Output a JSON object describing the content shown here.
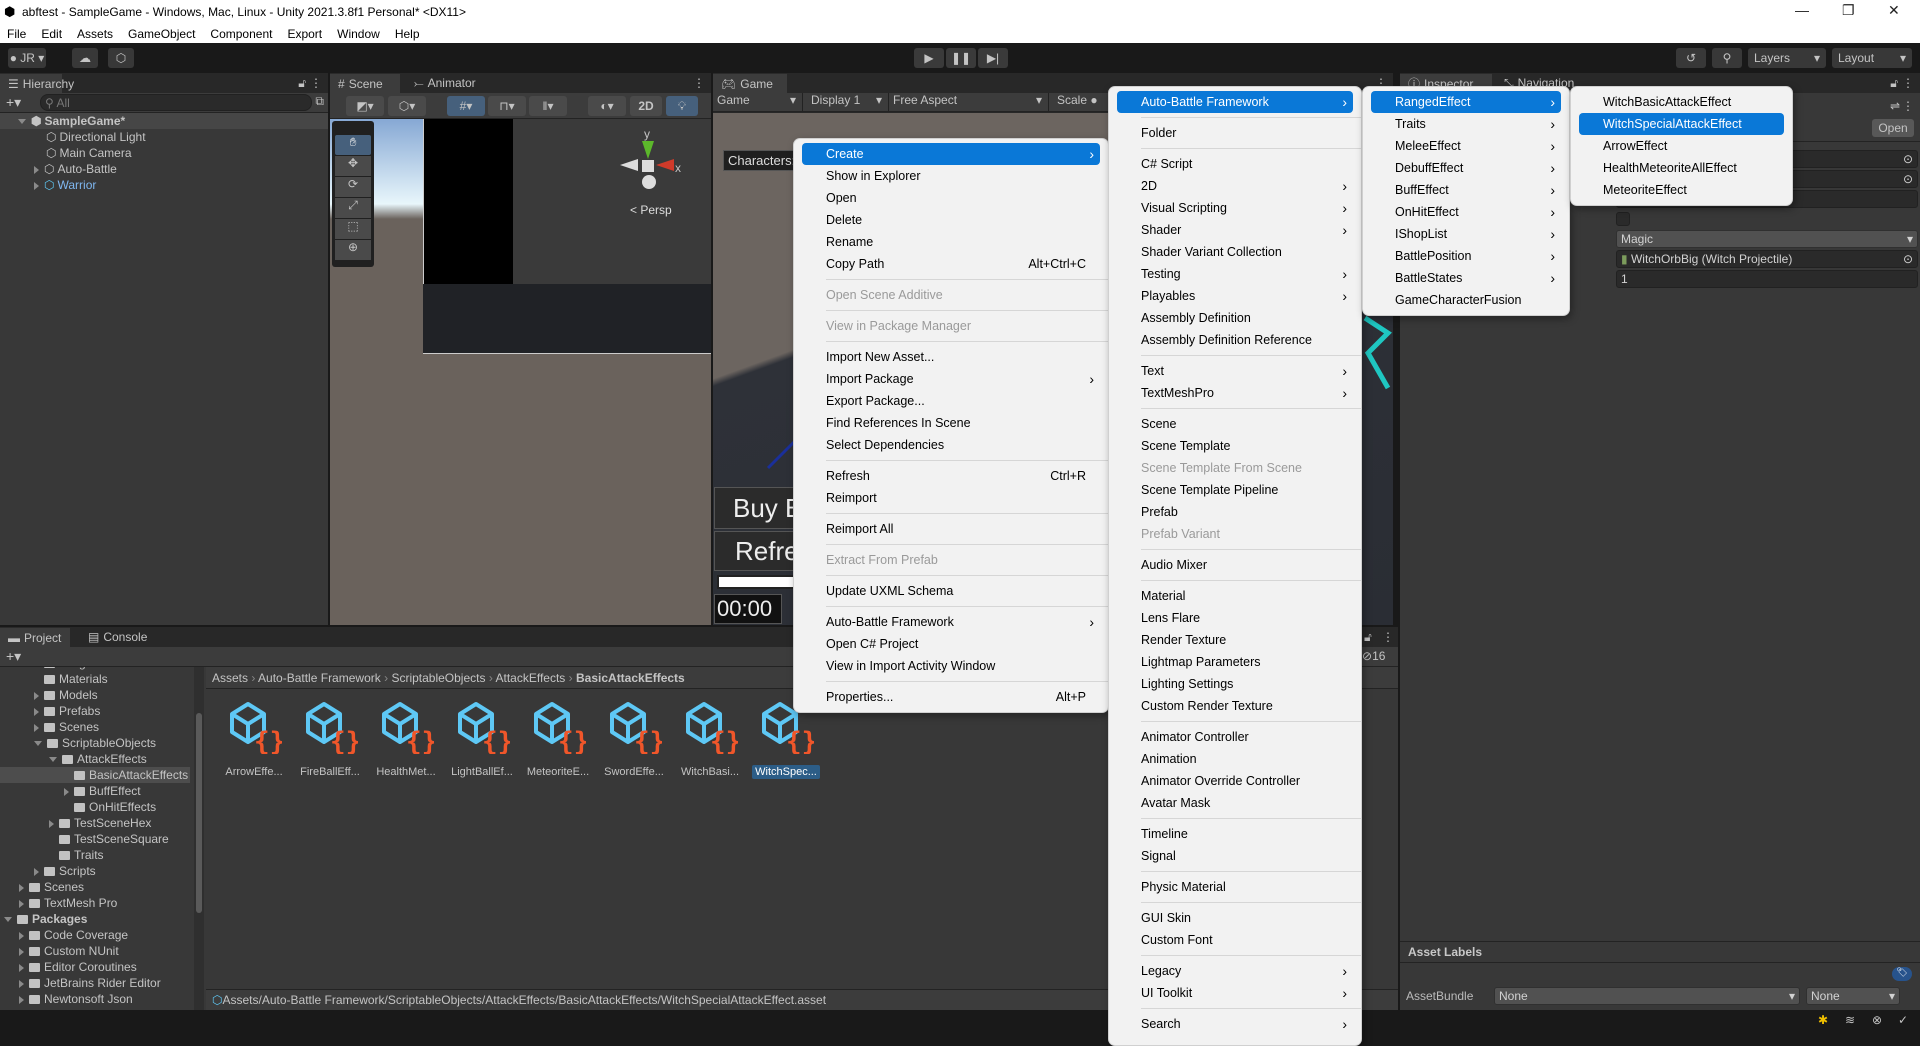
{
  "window": {
    "title": "abftest - SampleGame - Windows, Mac, Linux - Unity 2021.3.8f1 Personal* <DX11>"
  },
  "menubar": [
    "File",
    "Edit",
    "Assets",
    "GameObject",
    "Component",
    "Export",
    "Window",
    "Help"
  ],
  "toolbar": {
    "account": "JR",
    "layers": "Layers",
    "layout": "Layout"
  },
  "hierarchy": {
    "tab": "Hierarchy",
    "search_placeholder": "All",
    "items": [
      {
        "label": "SampleGame*",
        "depth": 0,
        "expanded": true,
        "scene": true
      },
      {
        "label": "Directional Light",
        "depth": 1
      },
      {
        "label": "Main Camera",
        "depth": 1
      },
      {
        "label": "Auto-Battle",
        "depth": 1,
        "collapsed": true
      },
      {
        "label": "Warrior",
        "depth": 1,
        "collapsed": true,
        "prefab": true
      }
    ]
  },
  "scene": {
    "tab": "Scene",
    "tab2": "Animator",
    "btn_2d": "2D",
    "persp": "< Persp",
    "axis_y": "y",
    "axis_x": "x"
  },
  "game": {
    "tab": "Game",
    "mode": "Game",
    "display": "Display 1",
    "aspect": "Free Aspect",
    "scale": "Scale",
    "characters": "Characters:",
    "buy": "Buy B",
    "refresh": "Refre",
    "timer": "00:00",
    "teal": "#1fc7c2"
  },
  "inspector": {
    "tab": "Inspector",
    "tab2": "Navigation",
    "open": "Open",
    "dropdown": "Magic",
    "projectile": "WitchOrbBig (Witch Projectile)",
    "number": "1",
    "asset_labels": "Asset Labels",
    "asset_bundle": "AssetBundle",
    "bundle1": "None",
    "bundle2": "None"
  },
  "project": {
    "tab": "Project",
    "tab2": "Console",
    "count": "16",
    "breadcrumb": [
      "Assets",
      "Auto-Battle Framework",
      "ScriptableObjects",
      "AttackEffects",
      "BasicAttackEffects"
    ],
    "tree": [
      {
        "label": "Images",
        "depth": 2
      },
      {
        "label": "Materials",
        "depth": 2
      },
      {
        "label": "Models",
        "depth": 2,
        "collapsed": true
      },
      {
        "label": "Prefabs",
        "depth": 2,
        "collapsed": true
      },
      {
        "label": "Scenes",
        "depth": 2,
        "collapsed": true
      },
      {
        "label": "ScriptableObjects",
        "depth": 2,
        "expanded": true
      },
      {
        "label": "AttackEffects",
        "depth": 3,
        "expanded": true
      },
      {
        "label": "BasicAttackEffects",
        "depth": 4,
        "selected": true
      },
      {
        "label": "BuffEffect",
        "depth": 4,
        "collapsed": true
      },
      {
        "label": "OnHitEffects",
        "depth": 4
      },
      {
        "label": "TestSceneHex",
        "depth": 3,
        "collapsed": true
      },
      {
        "label": "TestSceneSquare",
        "depth": 3
      },
      {
        "label": "Traits",
        "depth": 3
      },
      {
        "label": "Scripts",
        "depth": 2,
        "collapsed": true
      },
      {
        "label": "Scenes",
        "depth": 1,
        "collapsed": true
      },
      {
        "label": "TextMesh Pro",
        "depth": 1,
        "collapsed": true
      },
      {
        "label": "Packages",
        "depth": 0,
        "expanded": true,
        "bold": true
      },
      {
        "label": "Code Coverage",
        "depth": 1,
        "collapsed": true
      },
      {
        "label": "Custom NUnit",
        "depth": 1,
        "collapsed": true
      },
      {
        "label": "Editor Coroutines",
        "depth": 1,
        "collapsed": true
      },
      {
        "label": "JetBrains Rider Editor",
        "depth": 1,
        "collapsed": true
      },
      {
        "label": "Newtonsoft Json",
        "depth": 1,
        "collapsed": true
      }
    ],
    "assets": [
      {
        "label": "ArrowEffe..."
      },
      {
        "label": "FireBallEff..."
      },
      {
        "label": "HealthMet..."
      },
      {
        "label": "LightBallEf..."
      },
      {
        "label": "MeteoriteE..."
      },
      {
        "label": "SwordEffe..."
      },
      {
        "label": "WitchBasi..."
      },
      {
        "label": "WitchSpec...",
        "selected": true
      }
    ],
    "path": "Assets/Auto-Battle Framework/ScriptableObjects/AttackEffects/BasicAttackEffects/WitchSpecialAttackEffect.asset"
  },
  "context_menu": [
    {
      "label": "Create",
      "submenu": true,
      "highlighted": true
    },
    {
      "label": "Show in Explorer"
    },
    {
      "label": "Open"
    },
    {
      "label": "Delete"
    },
    {
      "label": "Rename"
    },
    {
      "label": "Copy Path",
      "shortcut": "Alt+Ctrl+C"
    },
    {
      "label": "Open Scene Additive",
      "disabled": true,
      "sep_before": true
    },
    {
      "label": "View in Package Manager",
      "disabled": true,
      "sep_before": true
    },
    {
      "label": "Import New Asset...",
      "sep_before": true
    },
    {
      "label": "Import Package",
      "submenu": true
    },
    {
      "label": "Export Package..."
    },
    {
      "label": "Find References In Scene"
    },
    {
      "label": "Select Dependencies"
    },
    {
      "label": "Refresh",
      "shortcut": "Ctrl+R",
      "sep_before": true
    },
    {
      "label": "Reimport"
    },
    {
      "label": "Reimport All",
      "sep_before": true
    },
    {
      "label": "Extract From Prefab",
      "disabled": true,
      "sep_before": true
    },
    {
      "label": "Update UXML Schema",
      "sep_before": true
    },
    {
      "label": "Auto-Battle Framework",
      "submenu": true,
      "sep_before": true
    },
    {
      "label": "Open C# Project"
    },
    {
      "label": "View in Import Activity Window"
    },
    {
      "label": "Properties...",
      "shortcut": "Alt+P",
      "sep_before": true
    }
  ],
  "create_menu": [
    {
      "label": "Auto-Battle Framework",
      "submenu": true,
      "highlighted": true
    },
    {
      "label": "Folder",
      "sep_before": true
    },
    {
      "label": "C# Script",
      "sep_before": true
    },
    {
      "label": "2D",
      "submenu": true
    },
    {
      "label": "Visual Scripting",
      "submenu": true
    },
    {
      "label": "Shader",
      "submenu": true
    },
    {
      "label": "Shader Variant Collection"
    },
    {
      "label": "Testing",
      "submenu": true
    },
    {
      "label": "Playables",
      "submenu": true
    },
    {
      "label": "Assembly Definition"
    },
    {
      "label": "Assembly Definition Reference"
    },
    {
      "label": "Text",
      "submenu": true,
      "sep_before": true
    },
    {
      "label": "TextMeshPro",
      "submenu": true
    },
    {
      "label": "Scene",
      "sep_before": true
    },
    {
      "label": "Scene Template"
    },
    {
      "label": "Scene Template From Scene",
      "disabled": true
    },
    {
      "label": "Scene Template Pipeline"
    },
    {
      "label": "Prefab"
    },
    {
      "label": "Prefab Variant",
      "disabled": true
    },
    {
      "label": "Audio Mixer",
      "sep_before": true
    },
    {
      "label": "Material",
      "sep_before": true
    },
    {
      "label": "Lens Flare"
    },
    {
      "label": "Render Texture"
    },
    {
      "label": "Lightmap Parameters"
    },
    {
      "label": "Lighting Settings"
    },
    {
      "label": "Custom Render Texture"
    },
    {
      "label": "Animator Controller",
      "sep_before": true
    },
    {
      "label": "Animation"
    },
    {
      "label": "Animator Override Controller"
    },
    {
      "label": "Avatar Mask"
    },
    {
      "label": "Timeline",
      "sep_before": true
    },
    {
      "label": "Signal"
    },
    {
      "label": "Physic Material",
      "sep_before": true
    },
    {
      "label": "GUI Skin",
      "sep_before": true
    },
    {
      "label": "Custom Font"
    },
    {
      "label": "Legacy",
      "submenu": true,
      "sep_before": true
    },
    {
      "label": "UI Toolkit",
      "submenu": true
    },
    {
      "label": "Search",
      "submenu": true,
      "sep_before": true
    }
  ],
  "abf_menu": [
    {
      "label": "RangedEffect",
      "submenu": true,
      "highlighted": true
    },
    {
      "label": "Traits",
      "submenu": true
    },
    {
      "label": "MeleeEffect",
      "submenu": true
    },
    {
      "label": "DebuffEffect",
      "submenu": true
    },
    {
      "label": "BuffEffect",
      "submenu": true
    },
    {
      "label": "OnHitEffect",
      "submenu": true
    },
    {
      "label": "IShopList",
      "submenu": true
    },
    {
      "label": "BattlePosition",
      "submenu": true
    },
    {
      "label": "BattleStates",
      "submenu": true
    },
    {
      "label": "GameCharacterFusion"
    }
  ],
  "ranged_menu": [
    {
      "label": "WitchBasicAttackEffect"
    },
    {
      "label": "WitchSpecialAttackEffect",
      "highlighted": true
    },
    {
      "label": "ArrowEffect"
    },
    {
      "label": "HealthMeteoriteAllEffect"
    },
    {
      "label": "MeteoriteEffect"
    }
  ],
  "colors": {
    "accent": "#0a78d7",
    "selection": "#2c5d87",
    "asset_cube": "#5ec8f5",
    "asset_brace": "#f0562a"
  }
}
